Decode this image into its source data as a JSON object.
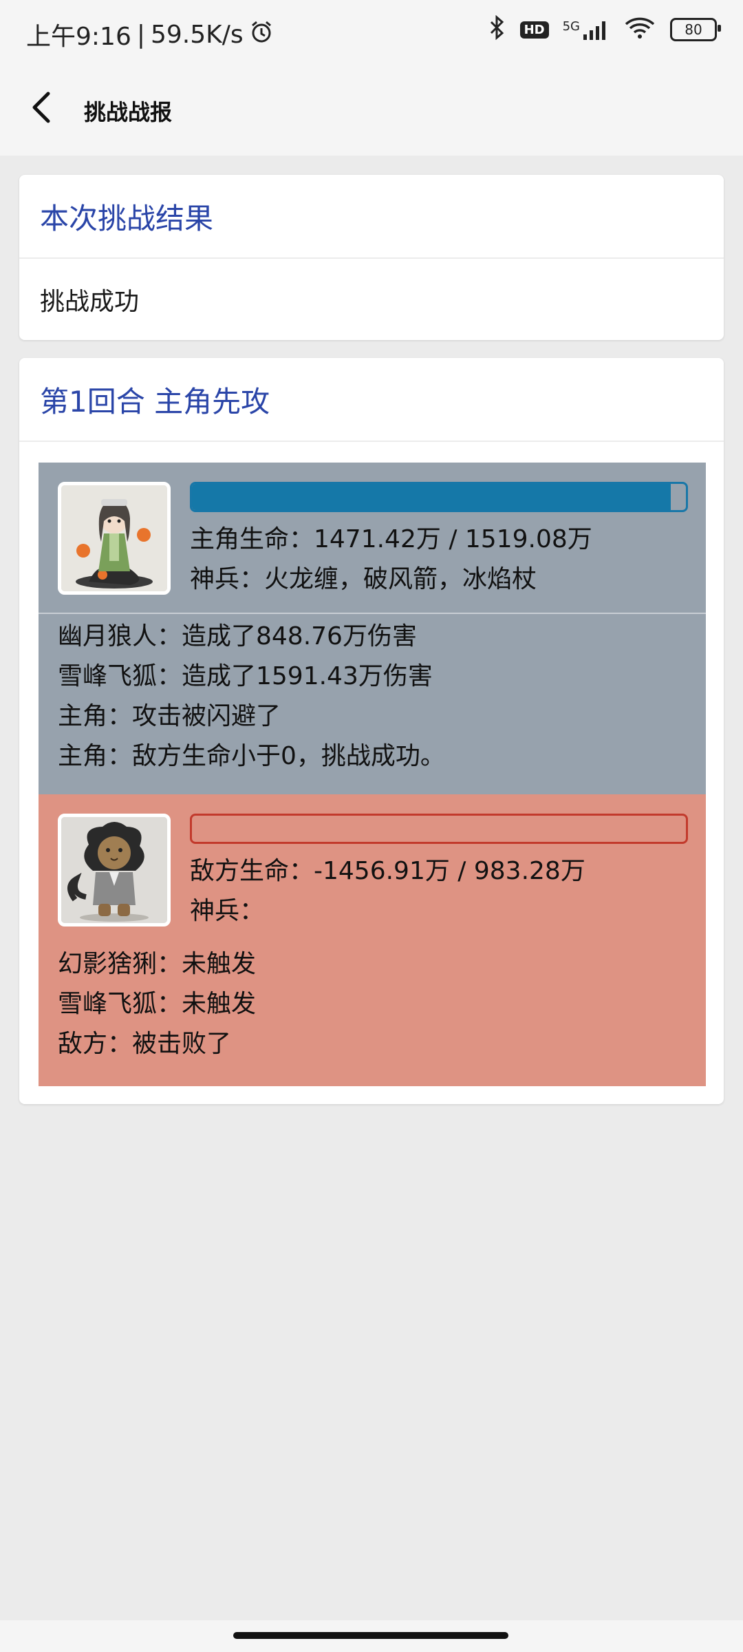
{
  "status_bar": {
    "time": "上午9:16",
    "network_speed": "59.5K/s",
    "network_type": "5G",
    "hd_label": "HD",
    "battery": "80"
  },
  "app_bar": {
    "title": "挑战战报"
  },
  "result_card": {
    "header": "本次挑战结果",
    "result": "挑战成功"
  },
  "round_card": {
    "header": "第1回合 主角先攻",
    "player": {
      "hp_fraction": 0.97,
      "hp_text": "主角生命：1471.42万 / 1519.08万",
      "weapons_text": "神兵：火龙缠，破风箭，冰焰杖",
      "logs": [
        "幽月狼人：造成了848.76万伤害",
        "雪峰飞狐：造成了1591.43万伤害",
        "主角：攻击被闪避了",
        "主角：敌方生命小于0，挑战成功。"
      ]
    },
    "enemy": {
      "hp_fraction": 0,
      "hp_text": "敌方生命：-1456.91万 / 983.28万",
      "weapons_text": "神兵：",
      "logs": [
        "幻影猞猁：未触发",
        "雪峰飞狐：未触发",
        "敌方：被击败了"
      ]
    }
  },
  "colors": {
    "accent": "#2a45a8",
    "player_panel": "#97a2ad",
    "enemy_panel": "#de9383",
    "player_hp": "#1578a8",
    "enemy_hp": "#c23a2c"
  }
}
